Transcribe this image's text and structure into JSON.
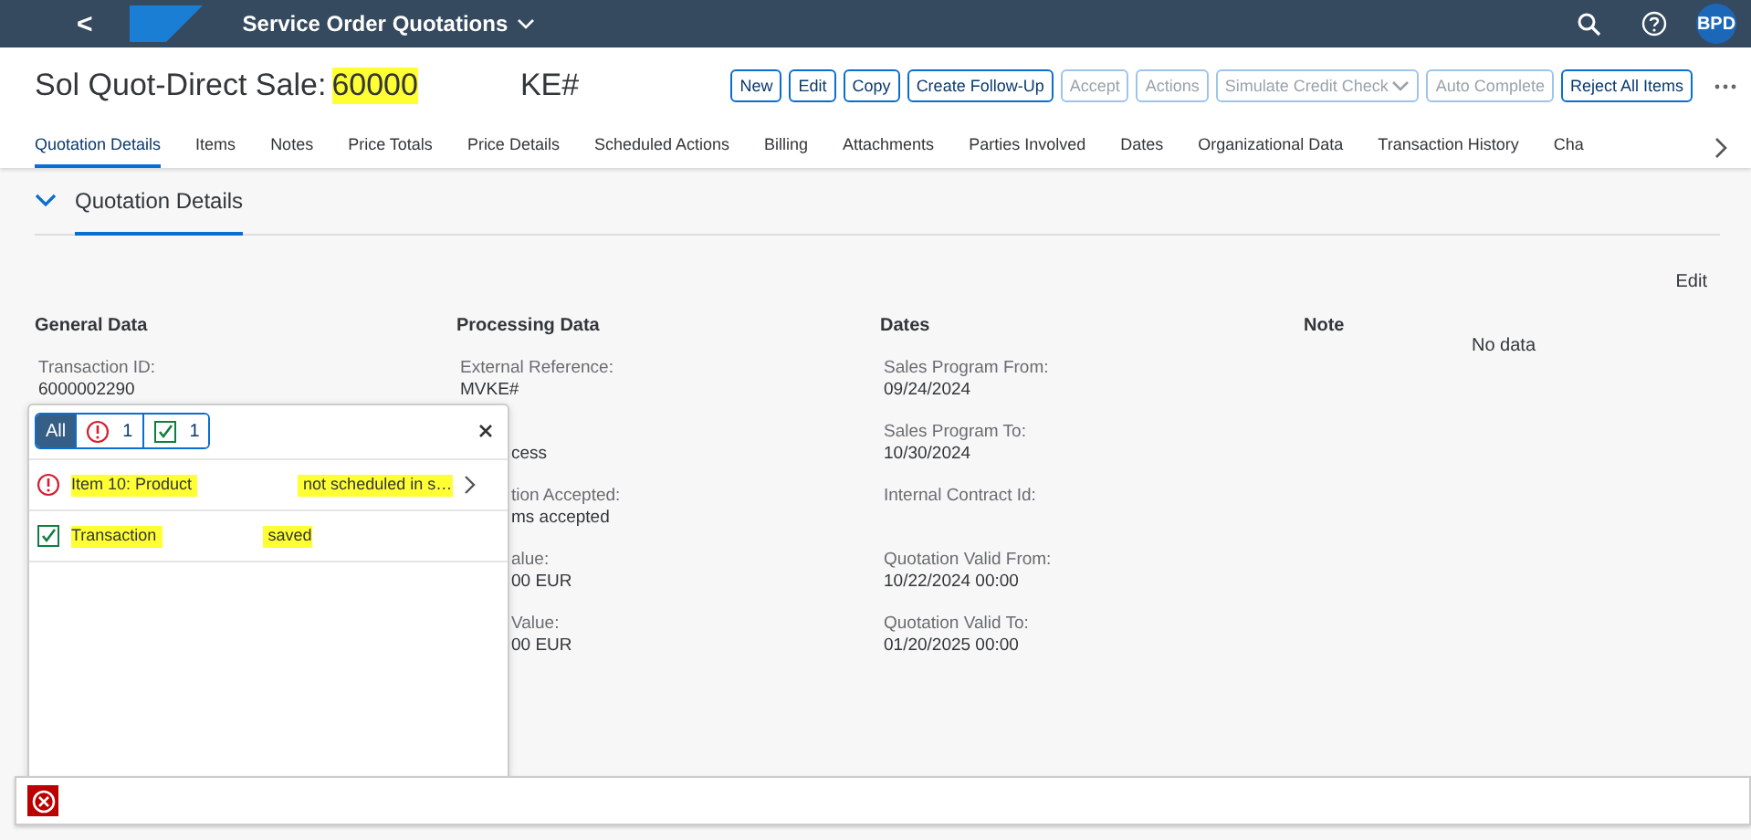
{
  "shell": {
    "back": "<",
    "app_title": "Service Order Quotations",
    "user_initials": "BPD"
  },
  "header": {
    "title_prefix": "Sol Quot-Direct Sale:",
    "title_id": "60000",
    "title_suffix": "KE#",
    "actions": [
      {
        "label": "New",
        "disabled": false,
        "dropdown": false
      },
      {
        "label": "Edit",
        "disabled": false,
        "dropdown": false
      },
      {
        "label": "Copy",
        "disabled": false,
        "dropdown": false
      },
      {
        "label": "Create Follow-Up",
        "disabled": false,
        "dropdown": false
      },
      {
        "label": "Accept",
        "disabled": true,
        "dropdown": false
      },
      {
        "label": "Actions",
        "disabled": true,
        "dropdown": false
      },
      {
        "label": "Simulate Credit Check",
        "disabled": true,
        "dropdown": true
      },
      {
        "label": "Auto Complete",
        "disabled": true,
        "dropdown": false
      },
      {
        "label": "Reject All Items",
        "disabled": false,
        "dropdown": false
      }
    ]
  },
  "tabs": [
    {
      "label": "Quotation Details",
      "selected": true
    },
    {
      "label": "Items",
      "selected": false
    },
    {
      "label": "Notes",
      "selected": false
    },
    {
      "label": "Price Totals",
      "selected": false
    },
    {
      "label": "Price Details",
      "selected": false
    },
    {
      "label": "Scheduled Actions",
      "selected": false
    },
    {
      "label": "Billing",
      "selected": false
    },
    {
      "label": "Attachments",
      "selected": false
    },
    {
      "label": "Parties Involved",
      "selected": false
    },
    {
      "label": "Dates",
      "selected": false
    },
    {
      "label": "Organizational Data",
      "selected": false
    },
    {
      "label": "Transaction History",
      "selected": false
    },
    {
      "label": "Cha",
      "selected": false
    }
  ],
  "section": {
    "title": "Quotation Details",
    "edit_link": "Edit",
    "columns": [
      {
        "heading": "General Data",
        "fields": [
          {
            "label": "Transaction ID:",
            "value": "6000002290",
            "covered": false
          }
        ]
      },
      {
        "heading": "Processing Data",
        "fields": [
          {
            "label": "External Reference:",
            "value": "MVKE#",
            "covered": false
          },
          {
            "value": "cess",
            "covered": true
          },
          {
            "label": "tion Accepted:",
            "value": "ms accepted",
            "covered": true
          },
          {
            "label": "alue:",
            "value": "00  EUR",
            "covered": true
          },
          {
            "label": "Value:",
            "value": "00  EUR",
            "covered": true
          }
        ]
      },
      {
        "heading": "Dates",
        "fields": [
          {
            "label": "Sales Program From:",
            "value": "09/24/2024",
            "covered": false
          },
          {
            "label": "Sales Program To:",
            "value": "10/30/2024",
            "covered": false
          },
          {
            "label": "Internal Contract Id:",
            "covered": false
          },
          {
            "label": "Quotation Valid From:",
            "value": "10/22/2024  00:00",
            "covered": false
          },
          {
            "label": "Quotation Valid To:",
            "value": "01/20/2025  00:00",
            "covered": false
          }
        ]
      },
      {
        "heading": "Note",
        "empty_text": "No data"
      }
    ]
  },
  "message_popover": {
    "filters": [
      {
        "kind": "all",
        "label": "All",
        "selected": true
      },
      {
        "kind": "error",
        "label": "1",
        "selected": false
      },
      {
        "kind": "success",
        "label": "1",
        "selected": false
      }
    ],
    "messages": [
      {
        "kind": "error",
        "parts": [
          "Item 10: Product",
          "not scheduled in s…"
        ],
        "highlighted": true,
        "navigable": true
      },
      {
        "kind": "success",
        "parts": [
          "Transaction",
          "saved"
        ],
        "highlighted": true,
        "navigable": false
      }
    ]
  },
  "footer": {
    "has_errors": true
  }
}
